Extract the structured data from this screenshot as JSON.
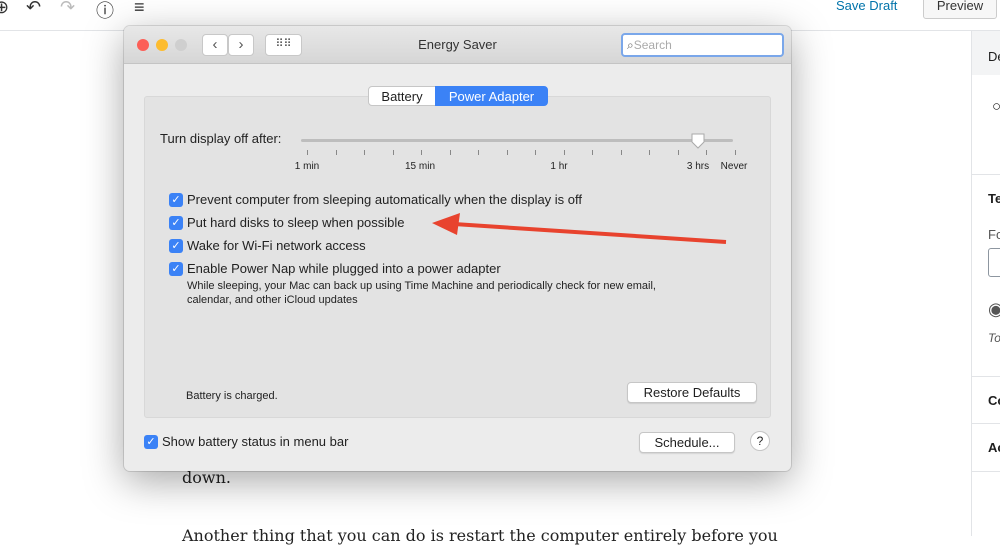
{
  "editor": {
    "toolbar": {
      "save_draft": "Save Draft",
      "preview": "Preview"
    },
    "body_lines": [
      "down.",
      "Another thing that you can do is restart the computer entirely before you"
    ],
    "sidebar_fragments": [
      "De",
      "Te",
      "Fo",
      "To",
      "Co",
      "Ac"
    ]
  },
  "window": {
    "title": "Energy Saver",
    "search_placeholder": "Search",
    "tabs": [
      {
        "label": "Battery",
        "selected": false
      },
      {
        "label": "Power Adapter",
        "selected": true
      }
    ],
    "display_off": {
      "label": "Turn display off after:",
      "tick_labels": [
        "1 min",
        "15 min",
        "1 hr",
        "3 hrs",
        "Never"
      ],
      "value": "3 hrs"
    },
    "options": [
      {
        "label": "Prevent computer from sleeping automatically when the display is off",
        "checked": true
      },
      {
        "label": "Put hard disks to sleep when possible",
        "checked": true
      },
      {
        "label": "Wake for Wi-Fi network access",
        "checked": true
      },
      {
        "label": "Enable Power Nap while plugged into a power adapter",
        "checked": true
      }
    ],
    "power_nap_note_1": "While sleeping, your Mac can back up using Time Machine and periodically check for new email,",
    "power_nap_note_2": "calendar, and other iCloud updates",
    "battery_status": "Battery is charged.",
    "restore_defaults": "Restore Defaults",
    "show_battery_status": {
      "label": "Show battery status in menu bar",
      "checked": true
    },
    "schedule": "Schedule...",
    "help": "?"
  },
  "colors": {
    "accent": "#3b82f6",
    "arrow": "#e8432e",
    "link": "#0073aa"
  }
}
